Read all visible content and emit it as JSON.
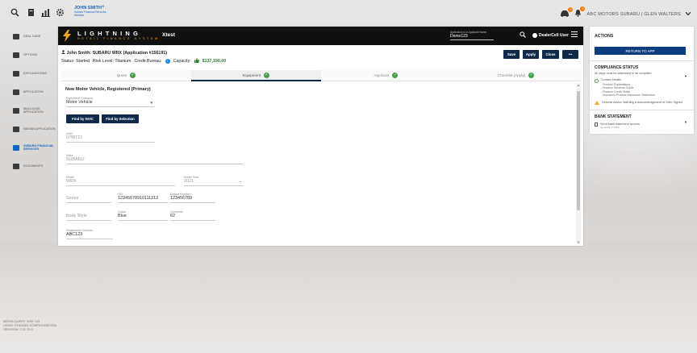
{
  "topbar": {
    "icons": [
      "search-icon",
      "documents-icon",
      "chart-icon",
      "settings-icon"
    ],
    "user_name": "JOHN SMITH",
    "user_company": "Subaru Financial Services",
    "user_role": "Website",
    "close_glyph": "×",
    "dealer_text": "ABC MOTORS SUBARU | GLEN WALTERS",
    "car_badge": "0",
    "bell_badge": "0"
  },
  "sidebar": {
    "items": [
      {
        "label": "DEAL CASE",
        "active": false
      },
      {
        "label": "OPTIONS",
        "active": false
      },
      {
        "label": "EXPLANATIONS",
        "active": false
      },
      {
        "label": "APPLICATION",
        "active": false
      },
      {
        "label": "MACLEASE APPLICATION",
        "active": false
      },
      {
        "label": "NISSAN APPLICATION",
        "active": false
      },
      {
        "label": "SUBARU FINANCIAL SERVICES",
        "active": true
      },
      {
        "label": "DOCUMENTS",
        "active": false
      }
    ]
  },
  "media_info": {
    "line1": "MEDIA QUERY SIZE: LG",
    "line2": "USING STAGING CONFIGURATION",
    "line3": "VERSION: 1.21.70.0"
  },
  "brand": {
    "title": "LIGHTNING",
    "subtitle": "RETAIL FINANCE SYSTEM",
    "env": "Xtest",
    "app_search_label": "Application # or Applicant Name",
    "app_search_value": "Demo123",
    "dealer_user": "DealerCell User",
    "colors": {
      "accent": "#f5a623",
      "navy": "#0d2a4a",
      "success": "#43a047"
    }
  },
  "app_header": {
    "applicant": "John Smith:",
    "vehicle": "SUBARU WRX",
    "application": "(Application #156191)",
    "status": "Status: Started",
    "risk": "Risk Level: Titanium",
    "credit": "Credit Bureau:",
    "capacity_label": "Capacity:",
    "capacity_value": "$137,190.00"
  },
  "actions": {
    "save": "Save",
    "apply": "Apply",
    "close": "Close",
    "more": "•••"
  },
  "tabs": [
    {
      "label": "Quote",
      "active": false
    },
    {
      "label": "Equipment",
      "active": true
    },
    {
      "label": "Applicant",
      "active": false
    },
    {
      "label": "Checklist (Apply)",
      "active": false
    }
  ],
  "form": {
    "section_title": "New Motor Vehicle, Registered (Primary)",
    "equipment_category_label": "Equipment Category",
    "equipment_category_value": "Motor Vehicle",
    "find_by_nvic": "Find by NVIC",
    "find_by_selection": "Find by Selection",
    "nvic_label": "NVIC",
    "nvic_value": "07WT21",
    "make_label": "Make",
    "make_value": "SUBARU",
    "model_label": "Model",
    "model_value": "WRX",
    "model_year_label": "Model Year",
    "model_year_value": "2021",
    "series_placeholder": "Series",
    "vin_label": "VIN",
    "vin_value": "12345678910111213",
    "engine_label": "Engine Number",
    "engine_value": "123456789",
    "body_style_placeholder": "Body Style",
    "colour_label": "Colour",
    "colour_value": "Blue",
    "odometer_label": "Odometer",
    "odometer_value": "62",
    "registration_label": "Registration Number",
    "registration_value": "ABC123"
  },
  "right_panel": {
    "actions_title": "ACTIONS",
    "return_button": "RETURN TO APP",
    "compliance_title": "COMPLIANCE STATUS",
    "compliance_desc": "All steps must be addressed to be compliant",
    "compliance_main": "Contact Details",
    "compliance_subs": [
      "- Product Explanations",
      "- Finance Services Guide",
      "- Finance Credit Guide",
      "- Insurance Product Disclosure Statement"
    ],
    "warning_text": "General Advice Warning & Acknowledgement of Offer Signed",
    "bank_title": "BANK STATEMENT",
    "bank_line1": "Send bank statement access",
    "bank_line2": "via email or SMS"
  }
}
